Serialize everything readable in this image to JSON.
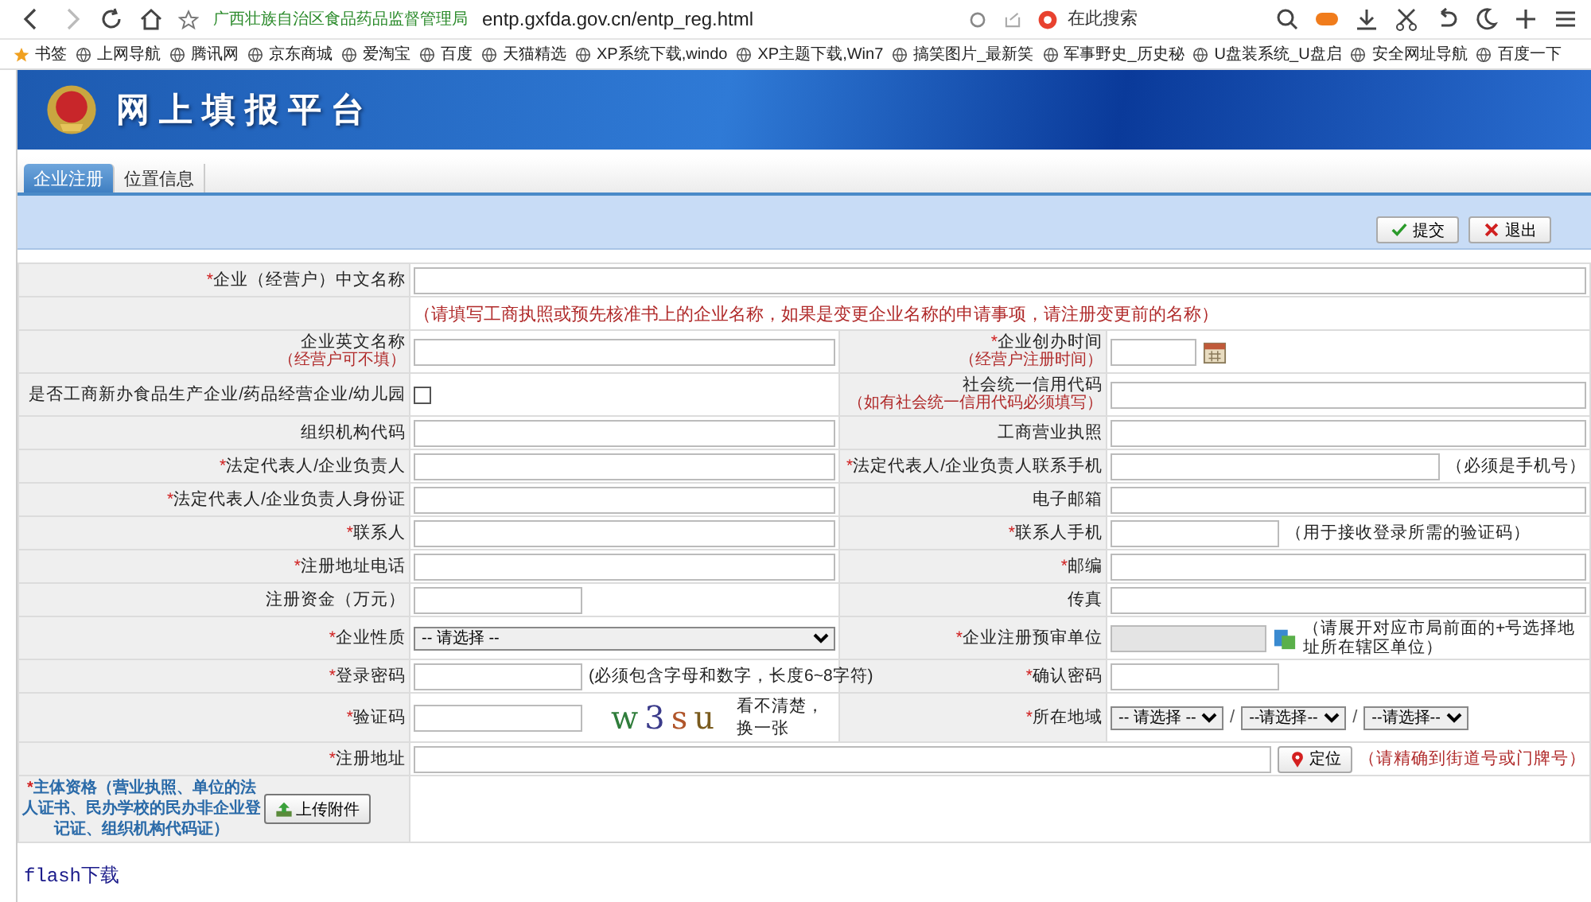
{
  "browser": {
    "site_title": "广西壮族自治区食品药品监督管理局",
    "url": "entp.gxfda.gov.cn/entp_reg.html",
    "search_placeholder": "在此搜索",
    "bookmarks": [
      "书签",
      "上网导航",
      "腾讯网",
      "京东商城",
      "爱淘宝",
      "百度",
      "天猫精选",
      "XP系统下载,windo",
      "XP主题下载,Win7",
      "搞笑图片_最新笑",
      "军事野史_历史秘",
      "U盘装系统_U盘启",
      "安全网址导航",
      "百度一下"
    ]
  },
  "header": {
    "title": "网上填报平台"
  },
  "tabs": [
    {
      "label": "企业注册",
      "selected": true
    },
    {
      "label": "位置信息",
      "selected": false
    }
  ],
  "actions": [
    {
      "label": "提交",
      "kind": "submit"
    },
    {
      "label": "退出",
      "kind": "exit"
    }
  ],
  "rows": [
    {
      "kind": "full",
      "cell": {
        "mark": "*",
        "label": "企业（经营户）中文名称",
        "field": {
          "kind": "text"
        }
      }
    },
    {
      "kind": "note",
      "text": "（请填写工商执照或预先核准书上的企业名称，如果是变更企业名称的申请事项，请注册变更前的名称）"
    },
    {
      "kind": "pair",
      "left": {
        "label": "企业英文名称",
        "sublabel": "（经营户可不填）",
        "field": {
          "kind": "text"
        }
      },
      "right": {
        "mark": "*",
        "label": "企业创办时间",
        "sublabel": "（经营户注册时间）",
        "field": {
          "kind": "date"
        }
      }
    },
    {
      "kind": "pair",
      "left": {
        "label": "是否工商新办食品生产企业/药品经营企业/幼儿园",
        "field": {
          "kind": "checkbox",
          "checked": false
        }
      },
      "right": {
        "label": "社会统一信用代码",
        "sublabel": "（如有社会统一信用代码必须填写）",
        "field": {
          "kind": "text"
        }
      }
    },
    {
      "kind": "pair",
      "left": {
        "label": "组织机构代码",
        "field": {
          "kind": "text"
        }
      },
      "right": {
        "label": "工商营业执照",
        "field": {
          "kind": "text"
        }
      }
    },
    {
      "kind": "pair",
      "left": {
        "mark": "*",
        "label": "法定代表人/企业负责人",
        "field": {
          "kind": "text"
        }
      },
      "right": {
        "mark": "*",
        "label": "法定代表人/企业负责人联系手机",
        "field": {
          "kind": "text"
        },
        "hint": "（必须是手机号）"
      }
    },
    {
      "kind": "pair",
      "left": {
        "mark": "*",
        "label": "法定代表人/企业负责人身份证",
        "field": {
          "kind": "text"
        }
      },
      "right": {
        "label": "电子邮箱",
        "field": {
          "kind": "text"
        }
      }
    },
    {
      "kind": "pair",
      "left": {
        "mark": "*",
        "label": "联系人",
        "field": {
          "kind": "text"
        }
      },
      "right": {
        "mark": "*",
        "label": "联系人手机",
        "field": {
          "kind": "short"
        },
        "hint": "（用于接收登录所需的验证码）"
      }
    },
    {
      "kind": "pair",
      "left": {
        "mark": "*",
        "label": "注册地址电话",
        "field": {
          "kind": "text"
        }
      },
      "right": {
        "mark": "*",
        "label": "邮编",
        "field": {
          "kind": "text"
        }
      }
    },
    {
      "kind": "pair",
      "left": {
        "label": "注册资金（万元）",
        "field": {
          "kind": "short"
        }
      },
      "right": {
        "label": "传真",
        "field": {
          "kind": "text"
        }
      }
    },
    {
      "kind": "pair",
      "left": {
        "mark": "*",
        "label": "企业性质",
        "field": {
          "kind": "select",
          "value": "-- 请选择 --"
        }
      },
      "right": {
        "mark": "*",
        "label": "企业注册预审单位",
        "field": {
          "kind": "picker"
        },
        "hint": "（请展开对应市局前面的+号选择地址所在辖区单位）"
      }
    },
    {
      "kind": "pair",
      "left": {
        "mark": "*",
        "label": "登录密码",
        "field": {
          "kind": "short"
        },
        "hint": "(必须包含字母和数字，长度6~8字符)"
      },
      "right": {
        "mark": "*",
        "label": "确认密码",
        "field": {
          "kind": "short"
        }
      }
    },
    {
      "kind": "pair",
      "left": {
        "mark": "*",
        "label": "验证码",
        "field": {
          "kind": "captcha",
          "code": "w3su"
        },
        "hint": "看不清楚，换一张"
      },
      "right": {
        "mark": "*",
        "label": "所在地域",
        "field": {
          "kind": "regions",
          "options": [
            "-- 请选择 --",
            "--请选择--",
            "--请选择--"
          ],
          "separator": "/"
        }
      }
    },
    {
      "kind": "full",
      "cell": {
        "mark": "*",
        "label": "注册地址",
        "field": {
          "kind": "locate",
          "button": "定位"
        },
        "hint": "（请精确到街道号或门牌号）"
      }
    },
    {
      "kind": "upload",
      "cell": {
        "mark": "*",
        "label": "主体资格（营业执照、单位的法人证书、民办学校的民办非企业登记证、组织机构代码证）",
        "button": "上传附件"
      }
    }
  ],
  "footer_link": "flash下载"
}
